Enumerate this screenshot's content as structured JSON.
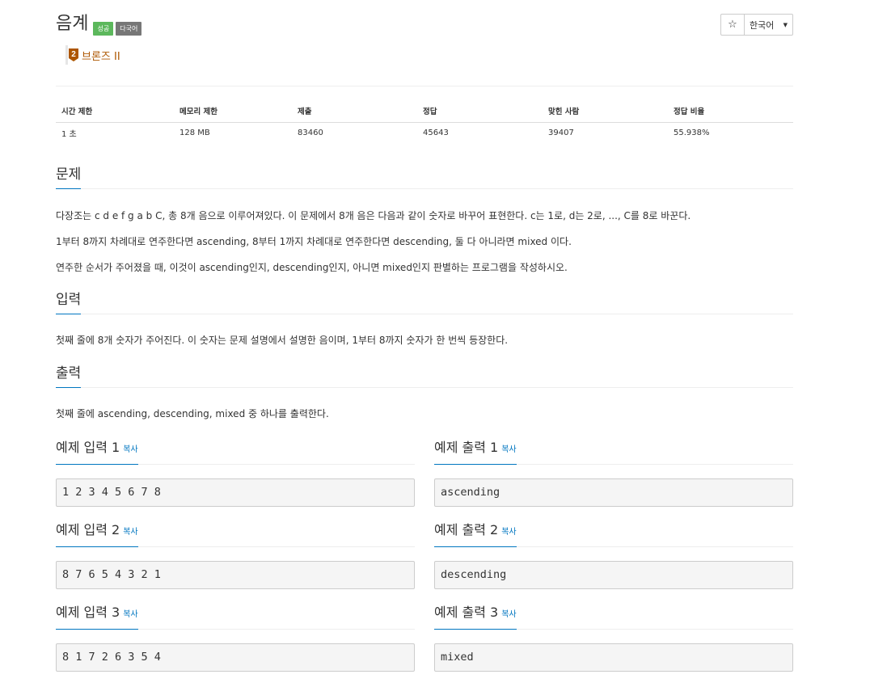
{
  "problem": {
    "title": "음계",
    "badges": [
      "성공",
      "다국어"
    ],
    "tier_number": "2",
    "tier_label": "브론즈 II"
  },
  "toolbar": {
    "star_label": "☆",
    "language_label": "한국어",
    "language_caret": "▼"
  },
  "info_table": {
    "headers": [
      "시간 제한",
      "메모리 제한",
      "제출",
      "정답",
      "맞힌 사람",
      "정답 비율"
    ],
    "values": [
      "1 초",
      "128 MB",
      "83460",
      "45643",
      "39407",
      "55.938%"
    ]
  },
  "sections": {
    "description": {
      "heading": "문제",
      "paragraphs": [
        "다장조는 c d e f g a b C, 총 8개 음으로 이루어져있다. 이 문제에서 8개 음은 다음과 같이 숫자로 바꾸어 표현한다. c는 1로, d는 2로, ..., C를 8로 바꾼다.",
        "1부터 8까지 차례대로 연주한다면 ascending, 8부터 1까지 차례대로 연주한다면 descending, 둘 다 아니라면 mixed 이다.",
        "연주한 순서가 주어졌을 때, 이것이 ascending인지, descending인지, 아니면 mixed인지 판별하는 프로그램을 작성하시오."
      ]
    },
    "input": {
      "heading": "입력",
      "text": "첫째 줄에 8개 숫자가 주어진다. 이 숫자는 문제 설명에서 설명한 음이며, 1부터 8까지 숫자가 한 번씩 등장한다."
    },
    "output": {
      "heading": "출력",
      "text": "첫째 줄에 ascending, descending, mixed 중 하나를 출력한다."
    }
  },
  "samples": {
    "copy_label": "복사",
    "items": [
      {
        "input_title": "예제 입력 1",
        "input": "1 2 3 4 5 6 7 8",
        "output_title": "예제 출력 1",
        "output": "ascending"
      },
      {
        "input_title": "예제 입력 2",
        "input": "8 7 6 5 4 3 2 1",
        "output_title": "예제 출력 2",
        "output": "descending"
      },
      {
        "input_title": "예제 입력 3",
        "input": "8 1 7 2 6 3 5 4",
        "output_title": "예제 출력 3",
        "output": "mixed"
      }
    ]
  },
  "colors": {
    "success_badge": "#5cb85c",
    "default_badge": "#777777",
    "tier_bronze": "#ad5600",
    "link_blue": "#0076c0"
  }
}
